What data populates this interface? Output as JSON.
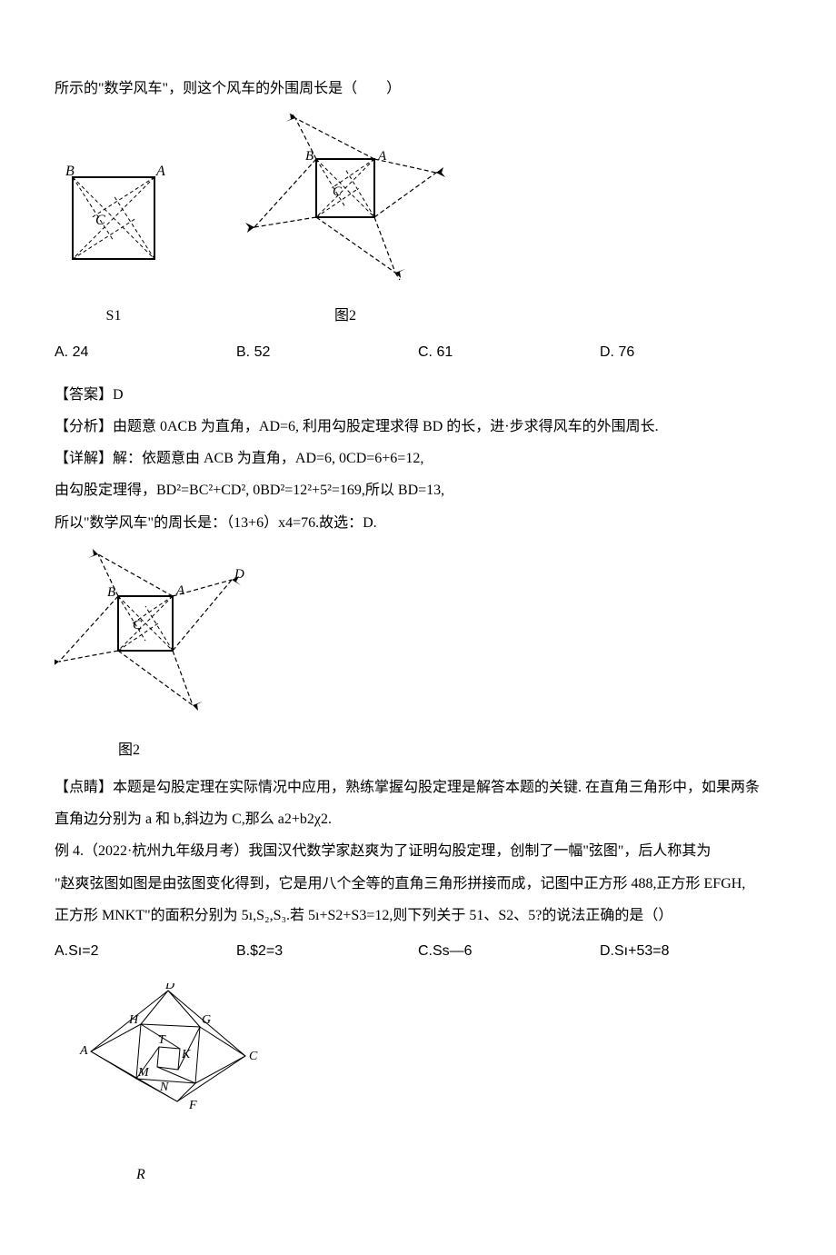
{
  "intro_line": "所示的\"数学风车\"，则这个风车的外围周长是（　　）",
  "fig1_caption": "S1",
  "fig2_caption": "图2",
  "labels": {
    "A": "A",
    "B": "B",
    "C": "C",
    "D": "D"
  },
  "options": {
    "A": "A. 24",
    "B": "B.   52",
    "C": "C.   61",
    "D": "D. 76"
  },
  "answer_label": "【答案】D",
  "analysis_label": "【分析】由题意 0ACB 为直角，AD=6, 利用勾股定理求得 BD 的长，进·步求得风车的外围周长.",
  "detail_line1": "【详解】解：依题意由 ACB 为直角，AD=6, 0CD=6+6=12,",
  "detail_line2": "由勾股定理得，BD²=BC²+CD², 0BD²=12²+5²=169,所以  BD=13,",
  "detail_line3": "所以\"数学风车\"的周长是：（13+6）x4=76.故选：D.",
  "solution_fig_caption": "图2",
  "dianjing_line1": "【点睛】本题是勾股定理在实际情况中应用，熟练掌握勾股定理是解答本题的关键. 在直角三角形中，如果两条",
  "dianjing_line2": "直角边分别为 a 和 b,斜边为 C,那么 a2+b2χ2.",
  "example4_line1": "例 4.（2022·杭州九年级月考）我国汉代数学家赵爽为了证明勾股定理，创制了一幅\"弦图\"，后人称其为",
  "example4_line2": "\"赵爽弦图如图是由弦图变化得到，它是用八个全等的直角三角形拼接而成，记图中正方形 488,正方形 EFGH,",
  "example4_line3": "正方形 MNKT\"的面积分别为 5ı,S₂,S₃.若 5ı+S2+S3=12,则下列关于 51、S2、5?的说法正确的是（）",
  "options2": {
    "A": "A.Sı=2",
    "B": "B.$2=3",
    "C": "C.Ss—6",
    "D": "D.Sı+53=8"
  },
  "zhao_labels": {
    "A": "A",
    "B": "R",
    "C": "C",
    "D": "D",
    "F": "F",
    "G": "G",
    "H": "H",
    "K": "K",
    "M": "M",
    "N": "N",
    "T": "T"
  }
}
